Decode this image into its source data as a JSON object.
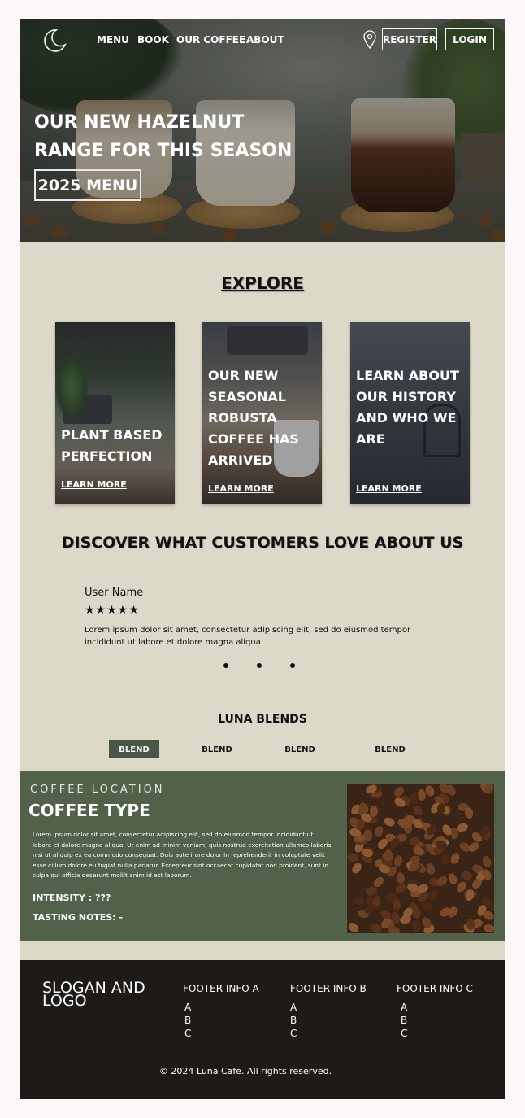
{
  "nav": {
    "links": [
      "MENU",
      "BOOK",
      "OUR COFFEE",
      "ABOUT"
    ],
    "register": "REGISTER",
    "login": "LOGIN"
  },
  "hero": {
    "title_line1": "OUR NEW HAZELNUT",
    "title_line2": "RANGE FOR THIS SEASON",
    "button": "2025 MENU"
  },
  "explore": {
    "title": "EXPLORE",
    "cards": [
      {
        "text": "PLANT BASED PERFECTION",
        "link": "LEARN MORE"
      },
      {
        "text": "OUR NEW SEASONAL ROBUSTA COFFEE HAS ARRIVED",
        "link": "LEARN MORE"
      },
      {
        "text": "LEARN ABOUT OUR HISTORY AND WHO WE ARE",
        "link": "LEARN MORE"
      }
    ]
  },
  "testimonials": {
    "title": "DISCOVER WHAT CUSTOMERS LOVE ABOUT US",
    "user_name": "User Name",
    "stars": "★★★★★",
    "review": "Lorem ipsum dolor sit amet, consectetur adipiscing elit, sed do eiusmod tempor incididunt ut labore et dolore magna aliqua."
  },
  "blends": {
    "title": "LUNA BLENDS",
    "tabs": [
      "BLEND",
      "BLEND",
      "BLEND",
      "BLEND"
    ]
  },
  "coffee": {
    "location": "COFFEE LOCATION",
    "type": "COFFEE TYPE",
    "description": "Lorem ipsum dolor sit amet, consectetur adipiscing elit, sed do eiusmod tempor incididunt ut labore et dolore magna aliqua. Ut enim ad minim veniam, quis nostrud exercitation ullamco laboris nisi ut aliquip ex ea commodo consequat. Duis aute irure dolor in reprehenderit in voluptate velit esse cillum dolore eu fugiat nulla pariatur. Excepteur sint occaecat cupidatat non proident, sunt in culpa qui officia deserunt mollit anim id est laborum.",
    "intensity": "INTENSITY : ???",
    "tasting_notes": "TASTING NOTES: -"
  },
  "footer": {
    "slogan": "SLOGAN AND LOGO",
    "columns": [
      {
        "heading": "FOOTER INFO A",
        "items": [
          "A",
          "B",
          "C"
        ]
      },
      {
        "heading": "FOOTER INFO B",
        "items": [
          "A",
          "B",
          "C"
        ]
      },
      {
        "heading": "FOOTER INFO C",
        "items": [
          "A",
          "B",
          "C"
        ]
      }
    ],
    "copyright": "© 2024 Luna Cafe. All rights reserved."
  },
  "colors": {
    "page_bg": "#ddd9c9",
    "panel_green": "#526149",
    "active_tab": "#4b5546",
    "footer_bg": "#1d1a17"
  }
}
